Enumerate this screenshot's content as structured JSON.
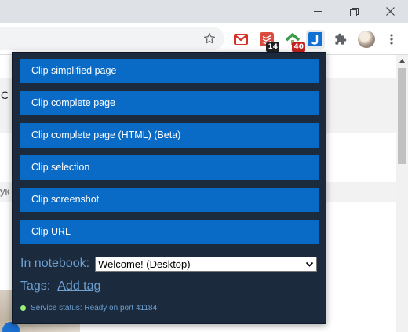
{
  "browser": {
    "window_controls": {
      "minimize": "—",
      "maximize": "❐",
      "close": "✕"
    },
    "extensions": [
      {
        "name": "gmail-extension",
        "icon": "gmail-icon",
        "badge": ""
      },
      {
        "name": "todoist-extension",
        "icon": "todoist-icon",
        "badge": "14"
      },
      {
        "name": "rtm-extension",
        "icon": "checkmark-up-icon",
        "badge": "40"
      },
      {
        "name": "joplin-extension",
        "icon": "joplin-j-icon",
        "badge": ""
      },
      {
        "name": "extensions-menu",
        "icon": "puzzle-icon",
        "badge": ""
      },
      {
        "name": "profile",
        "icon": "avatar",
        "badge": ""
      }
    ]
  },
  "page": {
    "partial_text_1": "C",
    "partial_text_2": "ук"
  },
  "popup": {
    "clip_buttons": [
      "Clip simplified page",
      "Clip complete page",
      "Clip complete page (HTML) (Beta)",
      "Clip selection",
      "Clip screenshot",
      "Clip URL"
    ],
    "notebook_label": "In notebook:",
    "notebook_value": "Welcome! (Desktop)",
    "tags_label": "Tags:",
    "add_tag_label": "Add tag",
    "status_text": "Service status: Ready on port 41184"
  },
  "colors": {
    "popup_bg": "#1b2a3d",
    "button_bg": "#0a6bc7",
    "label_blue": "#6d9fd1",
    "status_green": "#9bef74",
    "badge_red": "#c5221f"
  }
}
